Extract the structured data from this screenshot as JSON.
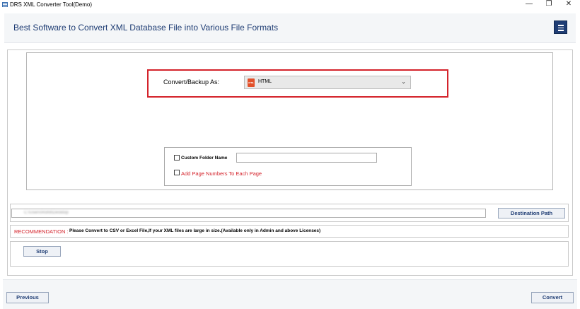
{
  "window": {
    "title": "DRS XML Converter Tool(Demo)",
    "minimize_glyph": "—",
    "restore_glyph": "❐",
    "close_glyph": "✕"
  },
  "header": {
    "title": "Best Software to Convert XML Database File into Various File Formats",
    "menu_icon": "hamburger-menu-icon"
  },
  "converter": {
    "label": "Convert/Backup As:",
    "selected_format": "HTML",
    "format_icon": "html-file-icon",
    "format_icon_text": "HTML",
    "chevron": "⌄",
    "highlight_color": "#d4232b"
  },
  "options": {
    "custom_folder_label": "Custom Folder Name",
    "custom_folder_value": "",
    "custom_folder_checked": false,
    "page_numbers_label": "Add Page Numbers To Each Page",
    "page_numbers_checked": false
  },
  "destination": {
    "path_value": "C:\\Users\\Rohit\\Desktop",
    "button_label": "Destination Path"
  },
  "recommendation": {
    "label": "RECOMMENDATION :",
    "text": "Please Convert to CSV or Excel File,If your XML files are large in size.(Available only in Admin and above Licenses)"
  },
  "status": {
    "stop_label": "Stop"
  },
  "footer": {
    "previous_label": "Previous",
    "convert_label": "Convert"
  },
  "colors": {
    "brand_blue": "#1f3d74",
    "accent_red": "#d4232b"
  }
}
